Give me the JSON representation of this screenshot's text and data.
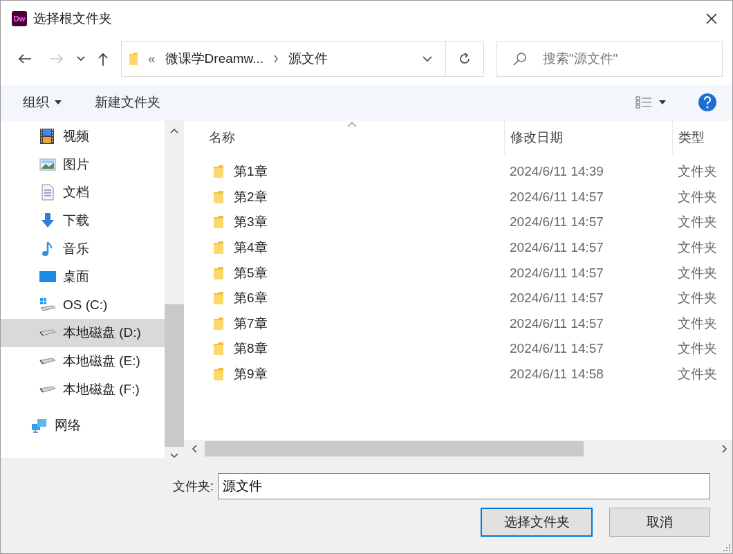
{
  "window": {
    "app_badge": "Dw",
    "title": "选择根文件夹"
  },
  "navigation": {
    "buttons": [
      {
        "kind": "back",
        "disabled": false
      },
      {
        "kind": "forward",
        "disabled": true
      },
      {
        "kind": "recent",
        "disabled": false
      },
      {
        "kind": "up",
        "disabled": false
      }
    ],
    "address": {
      "overflow_marker": "«",
      "breadcrumbs": [
        "微课学Dreamw...",
        "源文件"
      ]
    },
    "search": {
      "placeholder": "搜索\"源文件\""
    }
  },
  "toolbar": {
    "organize": "组织",
    "new_folder": "新建文件夹"
  },
  "sidebar": {
    "items": [
      {
        "kind": "video",
        "label": "视频",
        "selected": false
      },
      {
        "kind": "pictures",
        "label": "图片",
        "selected": false
      },
      {
        "kind": "documents",
        "label": "文档",
        "selected": false
      },
      {
        "kind": "downloads",
        "label": "下载",
        "selected": false
      },
      {
        "kind": "music",
        "label": "音乐",
        "selected": false
      },
      {
        "kind": "desktop",
        "label": "桌面",
        "selected": false
      },
      {
        "kind": "os_drive",
        "label": "OS (C:)",
        "selected": false
      },
      {
        "kind": "drive",
        "label": "本地磁盘 (D:)",
        "selected": true
      },
      {
        "kind": "drive",
        "label": "本地磁盘 (E:)",
        "selected": false
      },
      {
        "kind": "drive",
        "label": "本地磁盘 (F:)",
        "selected": false
      },
      {
        "kind": "network",
        "label": "网络",
        "selected": false
      }
    ]
  },
  "table": {
    "columns": [
      {
        "label": "名称",
        "sorted": true
      },
      {
        "label": "修改日期",
        "sorted": false
      },
      {
        "label": "类型",
        "sorted": false
      }
    ],
    "rows": [
      {
        "name": "第1章",
        "modified": "2024/6/11 14:39",
        "type": "文件夹"
      },
      {
        "name": "第2章",
        "modified": "2024/6/11 14:57",
        "type": "文件夹"
      },
      {
        "name": "第3章",
        "modified": "2024/6/11 14:57",
        "type": "文件夹"
      },
      {
        "name": "第4章",
        "modified": "2024/6/11 14:57",
        "type": "文件夹"
      },
      {
        "name": "第5章",
        "modified": "2024/6/11 14:57",
        "type": "文件夹"
      },
      {
        "name": "第6章",
        "modified": "2024/6/11 14:57",
        "type": "文件夹"
      },
      {
        "name": "第7章",
        "modified": "2024/6/11 14:57",
        "type": "文件夹"
      },
      {
        "name": "第8章",
        "modified": "2024/6/11 14:57",
        "type": "文件夹"
      },
      {
        "name": "第9章",
        "modified": "2024/6/11 14:58",
        "type": "文件夹"
      }
    ]
  },
  "folder_field": {
    "label": "文件夹:",
    "value": "源文件"
  },
  "buttons": [
    {
      "label": "选择文件夹",
      "default": true
    },
    {
      "label": "取消",
      "default": false
    }
  ]
}
